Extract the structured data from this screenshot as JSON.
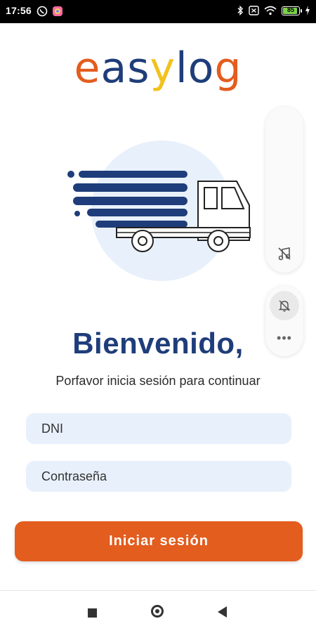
{
  "status_bar": {
    "time": "17:56",
    "battery_level": "85",
    "icons": [
      "whatsapp-icon",
      "app-icon",
      "bluetooth-icon",
      "no-sim-icon",
      "wifi-icon",
      "battery-icon",
      "charging-icon"
    ]
  },
  "logo": {
    "letters": [
      {
        "char": "e",
        "color": "#e35d1f"
      },
      {
        "char": "a",
        "color": "#1f3d7a"
      },
      {
        "char": "s",
        "color": "#1f3d7a"
      },
      {
        "char": "y",
        "color": "#f2c21b"
      },
      {
        "char": "l",
        "color": "#1f3d7a"
      },
      {
        "char": "o",
        "color": "#1f3d7a"
      },
      {
        "char": "g",
        "color": "#e35d1f"
      }
    ]
  },
  "hero": {
    "icon": "delivery-truck-illustration"
  },
  "side_panel": {
    "icons": [
      "music-off-icon",
      "bell-off-icon",
      "more-icon"
    ]
  },
  "main": {
    "welcome": "Bienvenido,",
    "subtitle": "Porfavor inicia sesión para continuar",
    "dni_placeholder": "DNI",
    "password_placeholder": "Contraseña",
    "login_label": "Iniciar sesión"
  },
  "colors": {
    "primary": "#1f3d7a",
    "accent": "#e35d1f",
    "field_bg": "#e8f0fb"
  },
  "nav_bar": {
    "icons": [
      "recents-icon",
      "home-icon",
      "back-icon"
    ]
  }
}
